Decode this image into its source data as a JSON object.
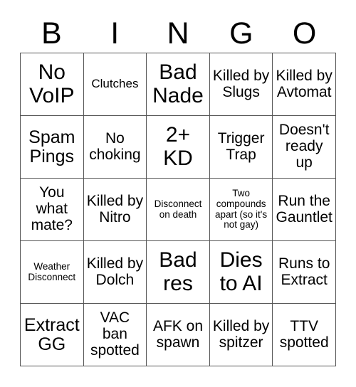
{
  "card": {
    "title": "BINGO",
    "header_letters": [
      "B",
      "I",
      "N",
      "G",
      "O"
    ],
    "grid_size": "5x5",
    "colors": {
      "background": "#ffffff",
      "text": "#000000",
      "border": "#555555"
    },
    "rows": [
      [
        {
          "label": "No VoIP",
          "size": "xl"
        },
        {
          "label": "Clutches",
          "size": "sm"
        },
        {
          "label": "Bad Nade",
          "size": "xl"
        },
        {
          "label": "Killed by Slugs",
          "size": "md"
        },
        {
          "label": "Killed by Avtomat",
          "size": "md"
        }
      ],
      [
        {
          "label": "Spam Pings",
          "size": "lg"
        },
        {
          "label": "No choking",
          "size": "md"
        },
        {
          "label": "2+ KD",
          "size": "xl"
        },
        {
          "label": "Trigger Trap",
          "size": "md"
        },
        {
          "label": "Doesn't ready up",
          "size": "md"
        }
      ],
      [
        {
          "label": "You what mate?",
          "size": "md"
        },
        {
          "label": "Killed by Nitro",
          "size": "md"
        },
        {
          "label": "Disconnect on death",
          "size": "xs"
        },
        {
          "label": "Two compounds apart (so it's not gay)",
          "size": "xs"
        },
        {
          "label": "Run the Gauntlet",
          "size": "md"
        }
      ],
      [
        {
          "label": "Weather Disconnect",
          "size": "xs"
        },
        {
          "label": "Killed by Dolch",
          "size": "md"
        },
        {
          "label": "Bad res",
          "size": "xl"
        },
        {
          "label": "Dies to AI",
          "size": "xl"
        },
        {
          "label": "Runs to Extract",
          "size": "md"
        }
      ],
      [
        {
          "label": "Extract GG",
          "size": "lg"
        },
        {
          "label": "VAC ban spotted",
          "size": "md"
        },
        {
          "label": "AFK on spawn",
          "size": "md"
        },
        {
          "label": "Killed by spitzer",
          "size": "md"
        },
        {
          "label": "TTV spotted",
          "size": "md"
        }
      ]
    ]
  }
}
